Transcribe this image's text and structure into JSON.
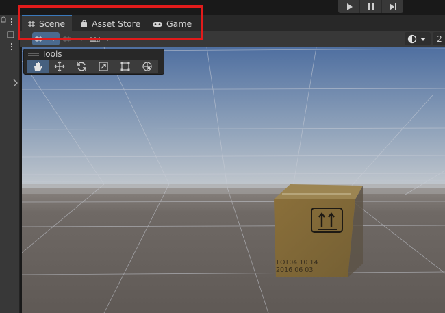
{
  "tabs": [
    {
      "label": "Scene",
      "icon": "grid-icon",
      "active": true
    },
    {
      "label": "Asset Store",
      "icon": "bag-icon",
      "active": false
    },
    {
      "label": "Game",
      "icon": "gamepad-icon",
      "active": false
    }
  ],
  "tools_panel": {
    "title": "Tools"
  },
  "toolbar": {
    "right_value": "2"
  },
  "box_label": {
    "line1": "LOT04 10 14",
    "line2": "2016 06 03"
  },
  "colors": {
    "accent": "#3a79bb",
    "highlight_box": "#e11b1b",
    "sky_top": "#4f6fa0",
    "ground": "#6a6460"
  }
}
